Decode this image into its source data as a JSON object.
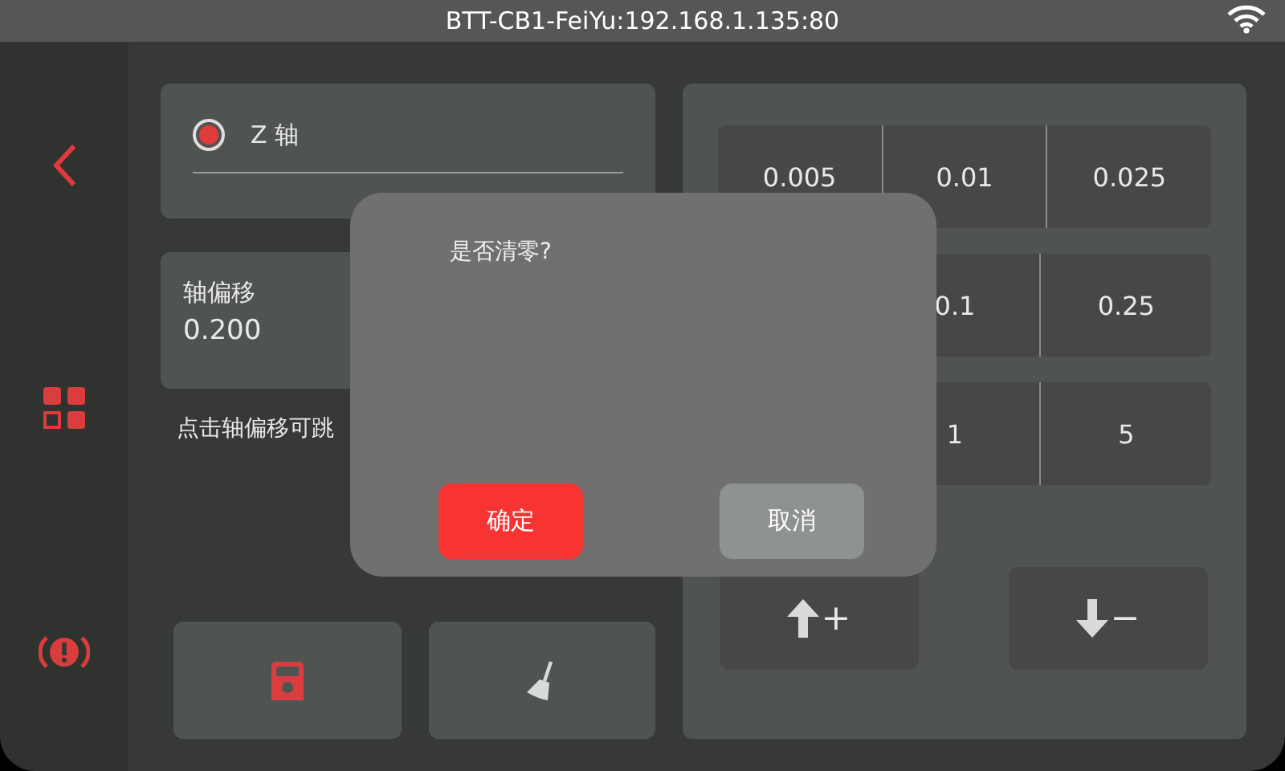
{
  "status_bar": {
    "title": "BTT-CB1-FeiYu:192.168.1.135:80"
  },
  "axis": {
    "label": "Z 轴",
    "selected": true
  },
  "offset": {
    "label": "轴偏移",
    "value": "0.200"
  },
  "hint": "点击轴偏移可跳",
  "steps": [
    {
      "cells": [
        "0.005",
        "0.01",
        "0.025"
      ]
    },
    {
      "cells": [
        "0.1",
        "0.25"
      ]
    },
    {
      "cells": [
        "1",
        "5"
      ]
    }
  ],
  "move_buttons": [
    {
      "label": "+",
      "kind": "up"
    },
    {
      "label": "−",
      "kind": "down"
    }
  ],
  "dialog": {
    "message": "是否清零?",
    "buttons": [
      {
        "label": "确定",
        "kind": "confirm"
      },
      {
        "label": "取消",
        "kind": "cancel"
      }
    ]
  }
}
